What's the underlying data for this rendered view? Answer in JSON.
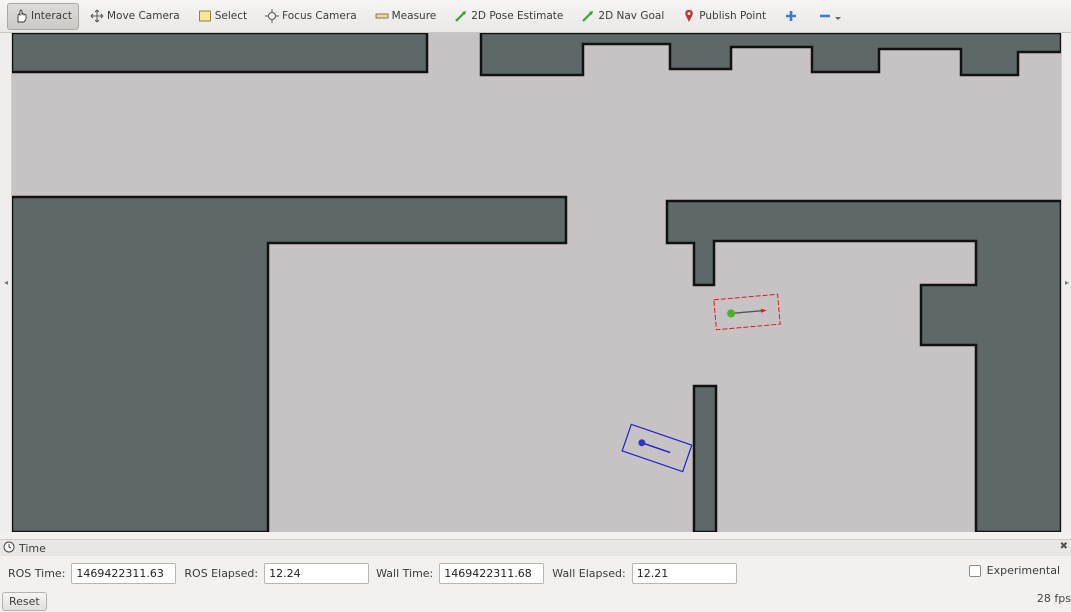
{
  "toolbar": {
    "tools": [
      {
        "label": "Interact",
        "icon": "hand-icon",
        "active": true
      },
      {
        "label": "Move Camera",
        "icon": "move-camera-icon"
      },
      {
        "label": "Select",
        "icon": "select-icon"
      },
      {
        "label": "Focus Camera",
        "icon": "focus-camera-icon"
      },
      {
        "label": "Measure",
        "icon": "ruler-icon"
      },
      {
        "label": "2D Pose Estimate",
        "icon": "green-arrow-icon"
      },
      {
        "label": "2D Nav Goal",
        "icon": "green-arrow-icon"
      },
      {
        "label": "Publish Point",
        "icon": "map-pin-icon"
      }
    ]
  },
  "colors": {
    "wall": "#5e6868",
    "free": "#c7c3c4",
    "robot1": "#e01818",
    "robot2": "#2020d0",
    "pose_dot1": "#4caf20",
    "pose_dot2": "#3333cc"
  },
  "time_panel": {
    "title": "Time",
    "ros_time_label": "ROS Time:",
    "ros_time": "1469422311.63",
    "ros_elapsed_label": "ROS Elapsed:",
    "ros_elapsed": "12.24",
    "wall_time_label": "Wall Time:",
    "wall_time": "1469422311.68",
    "wall_elapsed_label": "Wall Elapsed:",
    "wall_elapsed": "12.21",
    "experimental_label": "Experimental"
  },
  "bottom": {
    "reset_label": "Reset",
    "fps": "28 fps"
  }
}
